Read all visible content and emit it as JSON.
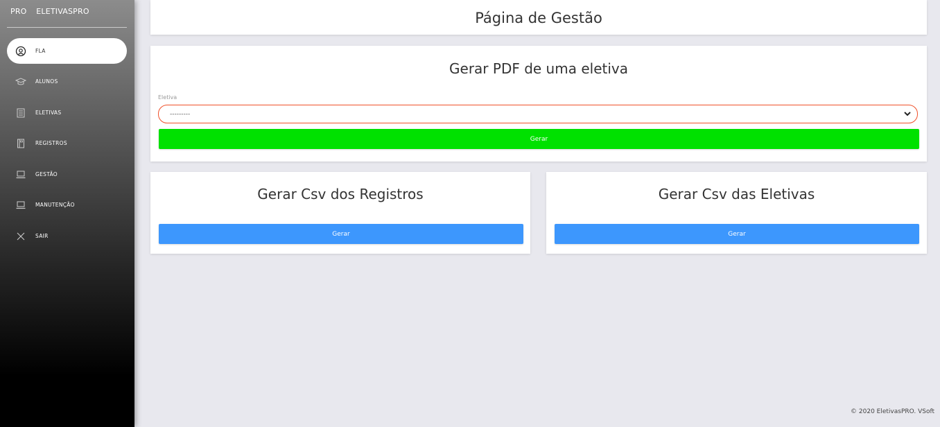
{
  "sidebar": {
    "brand_mini": "PRO",
    "brand_name": "ELETIVASPRO",
    "items": [
      {
        "label": "FLA",
        "icon": "user-circle-icon",
        "active": true
      },
      {
        "label": "ALUNOS",
        "icon": "graduation-cap-icon"
      },
      {
        "label": "ELETIVAS",
        "icon": "document-list-icon"
      },
      {
        "label": "REGISTROS",
        "icon": "notebook-icon"
      },
      {
        "label": "GESTÃO",
        "icon": "laptop-icon"
      },
      {
        "label": "MANUTENÇÃO",
        "icon": "laptop-icon"
      },
      {
        "label": "SAIR",
        "icon": "close-icon"
      }
    ]
  },
  "header": {
    "title": "Página de Gestão"
  },
  "pdf_card": {
    "title": "Gerar PDF de uma eletiva",
    "field_label": "Eletiva",
    "select_value": "---------",
    "button_label": "Gerar",
    "button_color": "#00e100"
  },
  "csv_registros": {
    "title": "Gerar Csv dos Registros",
    "button_label": "Gerar",
    "button_color": "#3d97fd"
  },
  "csv_eletivas": {
    "title": "Gerar Csv das Eletivas",
    "button_label": "Gerar",
    "button_color": "#3d97fd"
  },
  "footer": {
    "text": "© 2020 EletivasPRO. VSoft"
  }
}
